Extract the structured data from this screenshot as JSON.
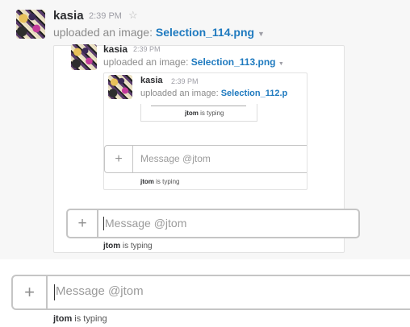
{
  "message": {
    "author": "kasia",
    "time": "2:39 PM",
    "star_icon": "star-outline-icon",
    "uploaded_text": "uploaded an image:",
    "file_name": "Selection_114.png",
    "caret_icon": "caret-down-icon"
  },
  "nested1": {
    "author": "kasia",
    "time": "2:39 PM",
    "uploaded_text": "uploaded an image:",
    "file_name": "Selection_113.png",
    "caret_icon": "caret-down-icon"
  },
  "nested2": {
    "author": "kasia",
    "time": "2:39 PM",
    "uploaded_text": "uploaded an image:",
    "file_name": "Selection_112.p"
  },
  "nested3": {
    "typing_user": "jtom",
    "typing_suffix": "is typing"
  },
  "composer_small": {
    "plus": "+",
    "placeholder": "Message @jtom",
    "typing_user": "jtom",
    "typing_suffix": "is typing"
  },
  "composer_mid": {
    "plus": "+",
    "placeholder": "Message @jtom",
    "typing_user": "jtom",
    "typing_suffix": "is typing"
  },
  "composer_main": {
    "plus": "+",
    "placeholder": "Message @jtom",
    "typing_user": "jtom",
    "typing_suffix": "is typing"
  },
  "colors": {
    "link": "#1f7abf",
    "background": "#f7f7f7",
    "border": "#c5c5c5"
  }
}
